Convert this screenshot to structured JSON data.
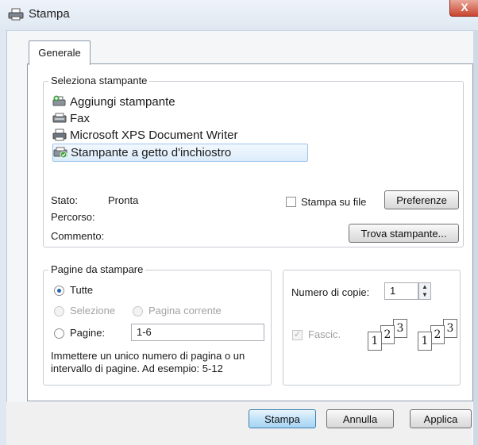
{
  "window": {
    "title": "Stampa",
    "close_glyph": "X"
  },
  "tabs": [
    {
      "label": "Generale"
    }
  ],
  "select_printer": {
    "group_label": "Seleziona stampante",
    "printers": [
      {
        "label": "Aggiungi stampante",
        "icon": "add-printer-icon"
      },
      {
        "label": "Fax",
        "icon": "fax-icon"
      },
      {
        "label": "Microsoft XPS Document Writer",
        "icon": "printer-icon"
      },
      {
        "label": "Stampante a getto d'inchiostro",
        "icon": "inkjet-printer-default-icon",
        "selected": true
      }
    ],
    "status_label": "Stato:",
    "status_value": "Pronta",
    "path_label": "Percorso:",
    "comment_label": "Commento:",
    "print_to_file_label": "Stampa su file",
    "preferences_button": "Preferenze",
    "find_printer_button": "Trova stampante..."
  },
  "pages": {
    "group_label": "Pagine da stampare",
    "all_label": "Tutte",
    "selection_label": "Selezione",
    "current_page_label": "Pagina corrente",
    "pages_label": "Pagine:",
    "pages_value": "1-6",
    "hint": "Immettere un unico numero di pagina o un intervallo di pagine. Ad esempio: 5-12"
  },
  "copies": {
    "label": "Numero di copie:",
    "value": "1",
    "collate_label": "Fascic.",
    "collate_pages": [
      "1",
      "2",
      "3"
    ]
  },
  "footer": {
    "print_button": "Stampa",
    "cancel_button": "Annulla",
    "apply_button": "Applica"
  }
}
